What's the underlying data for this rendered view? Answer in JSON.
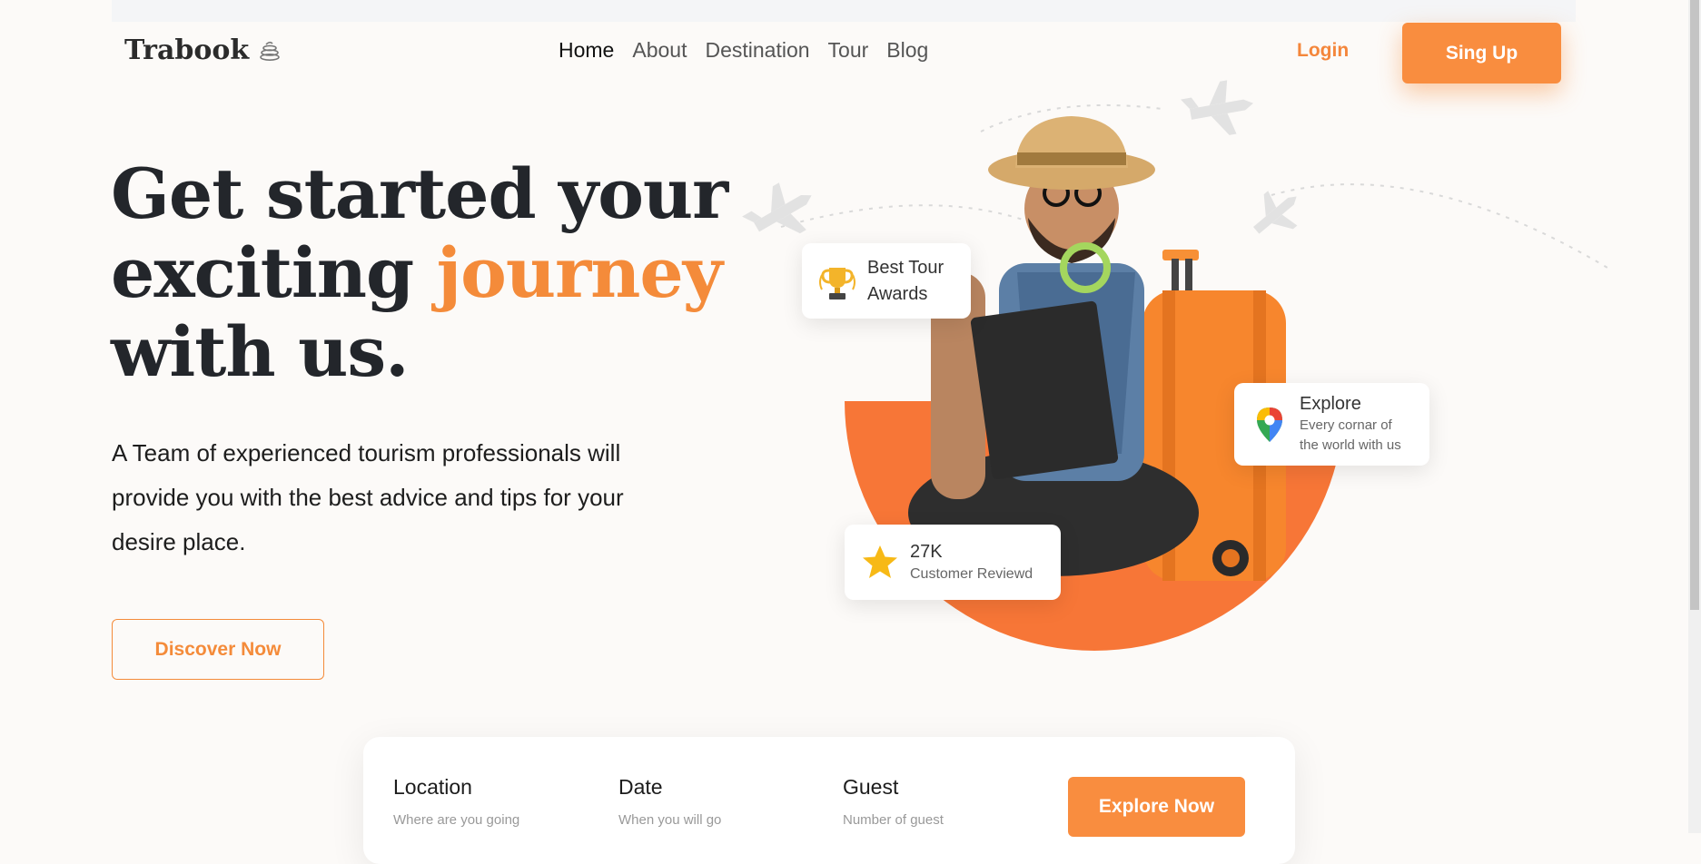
{
  "brand": {
    "name": "Trabook",
    "icon": "stack-icon"
  },
  "nav": {
    "items": [
      {
        "label": "Home",
        "active": true
      },
      {
        "label": "About"
      },
      {
        "label": "Destination"
      },
      {
        "label": "Tour"
      },
      {
        "label": "Blog"
      }
    ],
    "login_label": "Login",
    "signup_label": "Sing Up"
  },
  "hero": {
    "headline_line1": "Get started your",
    "headline_line2_start": "exciting",
    "headline_accent": "journey",
    "headline_line3": "with us.",
    "description": "A Team of experienced tourism professionals will provide you with the best advice and tips for your desire place.",
    "cta_label": "Discover Now"
  },
  "badges": {
    "awards": {
      "line1": "Best Tour",
      "line2": "Awards",
      "icon": "trophy-icon"
    },
    "explore": {
      "title": "Explore",
      "subtitle_line1": "Every cornar of",
      "subtitle_line2": "the world with us",
      "icon": "map-pin-icon"
    },
    "reviews": {
      "count": "27K",
      "label": "Customer Reviewd",
      "icon": "star-icon"
    }
  },
  "search": {
    "location": {
      "label": "Location",
      "placeholder": "Where are you going"
    },
    "date": {
      "label": "Date",
      "placeholder": "When you will go"
    },
    "guest": {
      "label": "Guest",
      "placeholder": "Number of guest"
    },
    "button_label": "Explore Now"
  },
  "colors": {
    "accent": "#f98d3f",
    "dark": "#23262b",
    "background": "#fcfaf8"
  }
}
